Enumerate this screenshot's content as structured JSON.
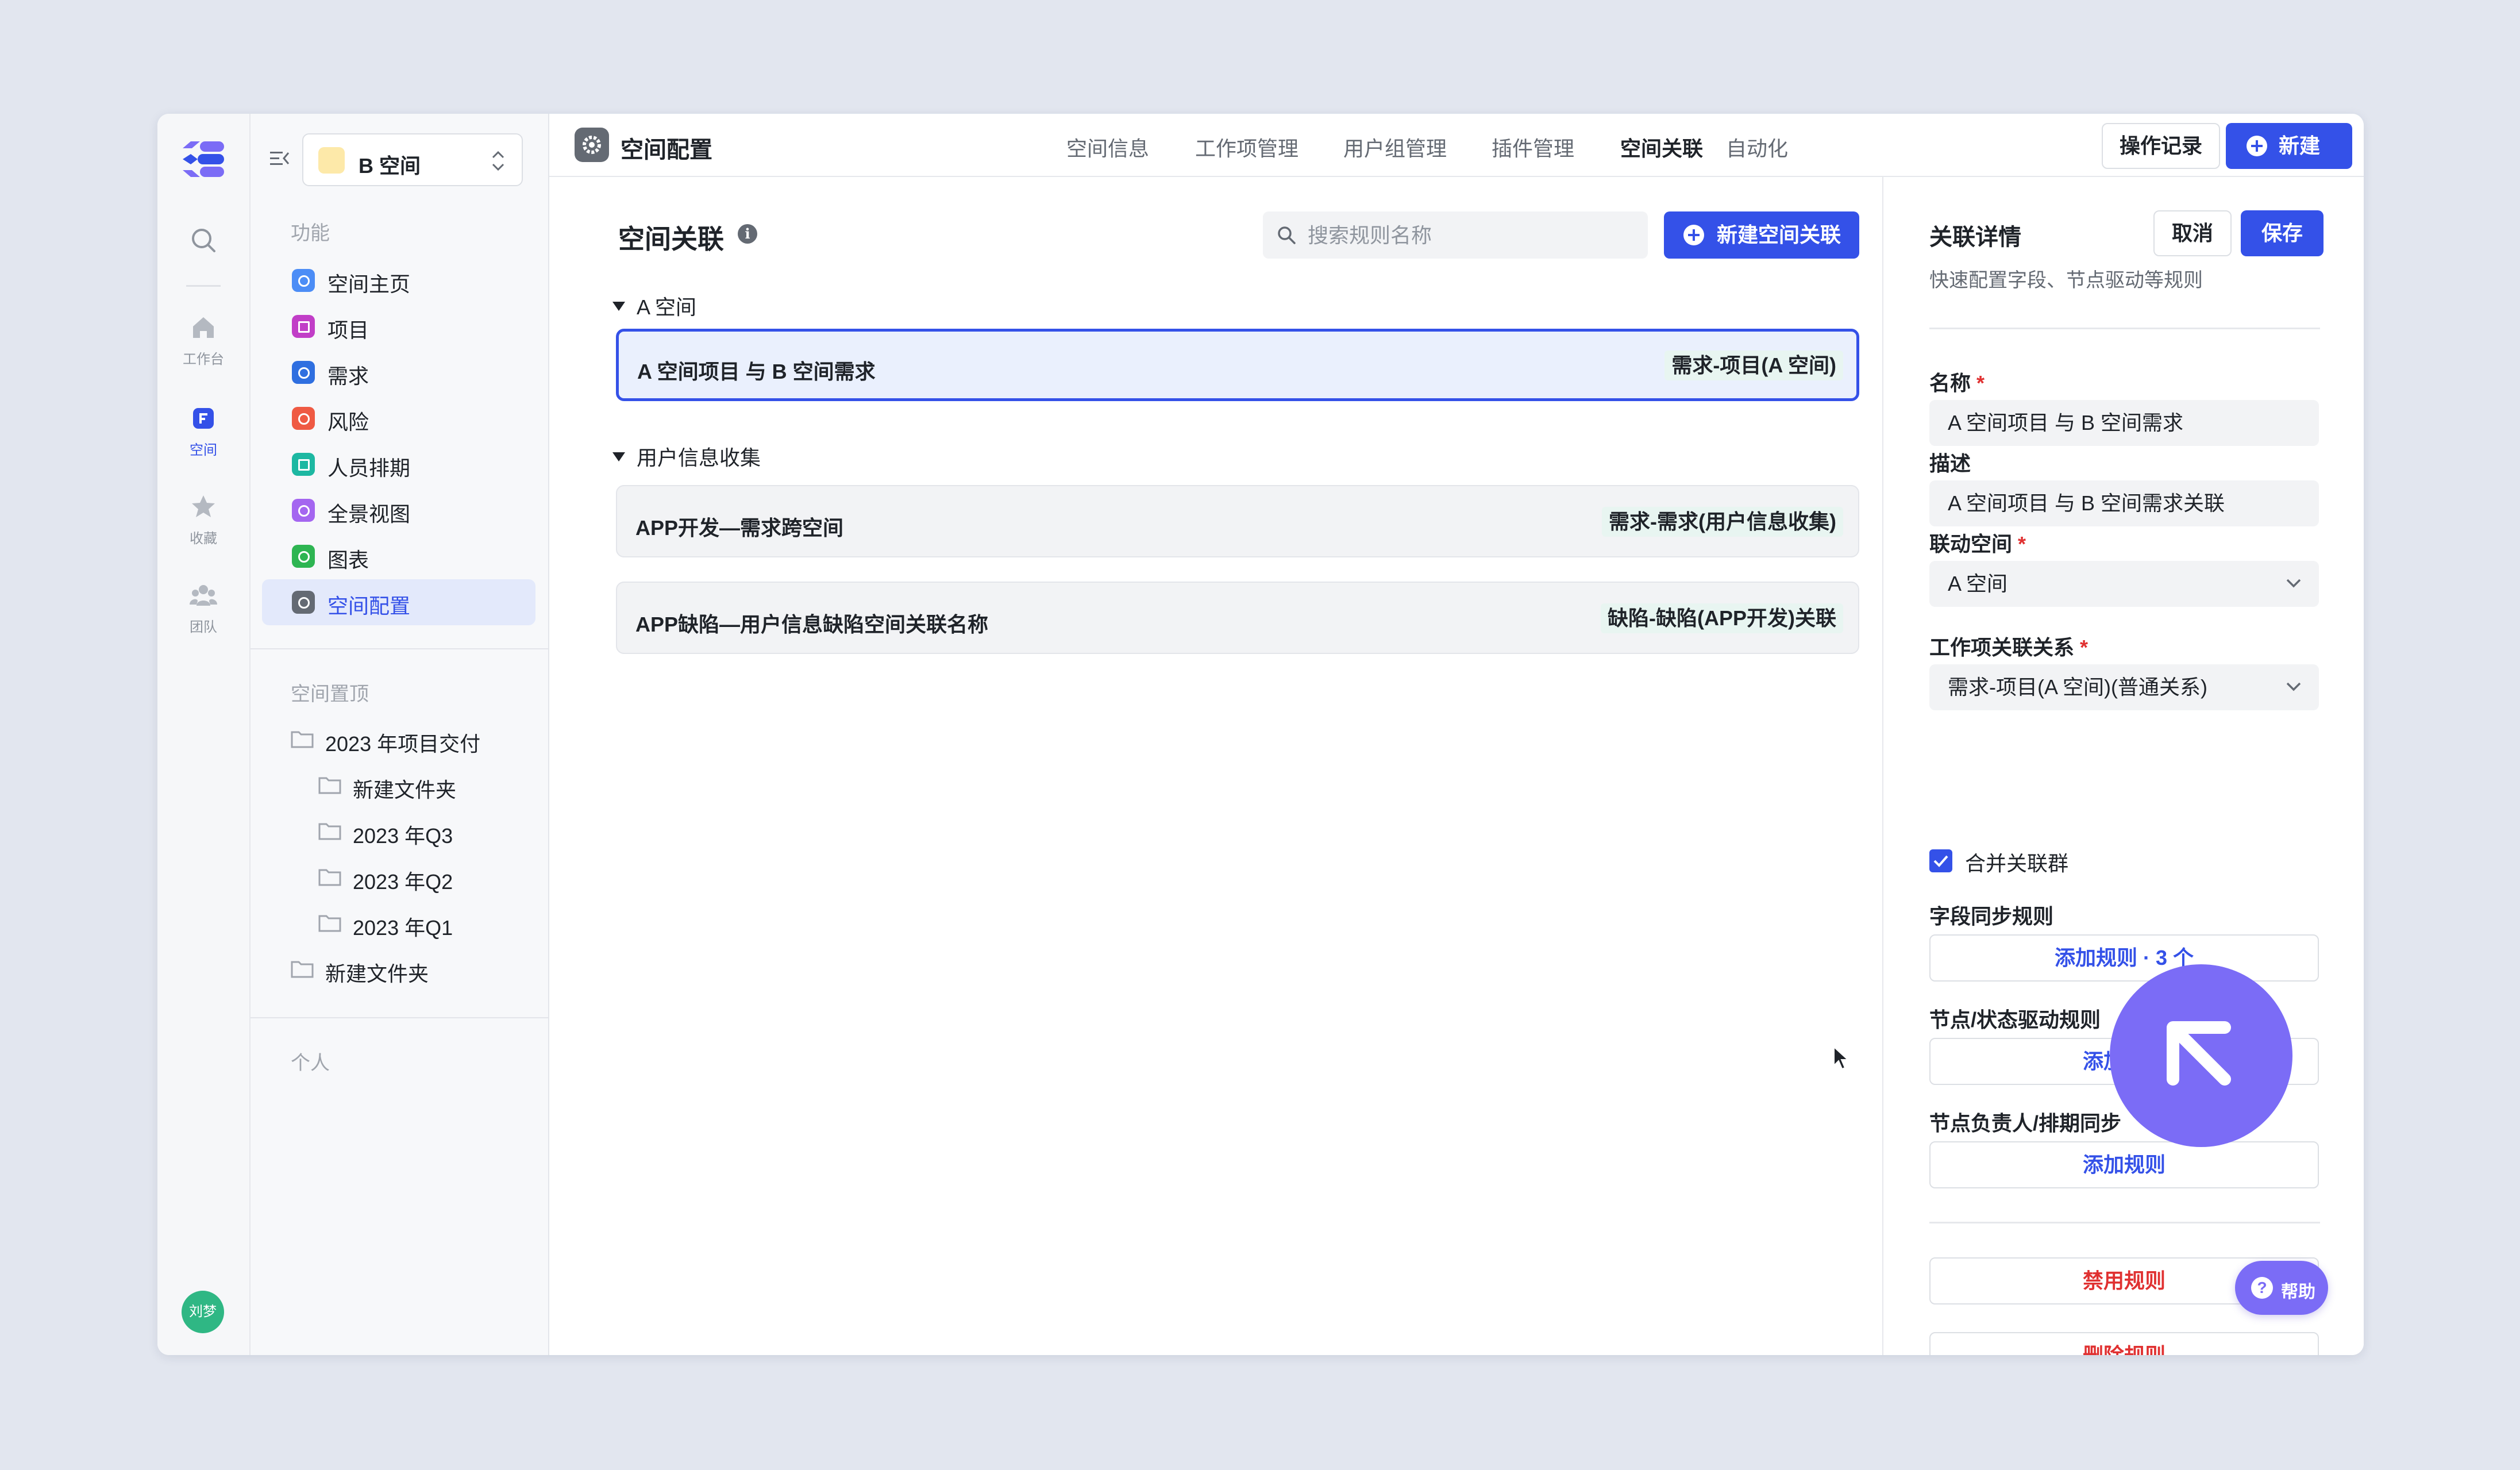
{
  "rail": {
    "items": [
      {
        "label": "工作台",
        "icon": "home-icon"
      },
      {
        "label": "空间",
        "icon": "space-icon"
      },
      {
        "label": "收藏",
        "icon": "star-icon"
      },
      {
        "label": "团队",
        "icon": "team-icon"
      }
    ],
    "avatar_text": "刘梦"
  },
  "sidebar": {
    "space_name": "B 空间",
    "section_function": "功能",
    "items": [
      {
        "label": "空间主页",
        "color": "#4c8df6"
      },
      {
        "label": "项目",
        "color": "#c13ec7"
      },
      {
        "label": "需求",
        "color": "#2f6fe0"
      },
      {
        "label": "风险",
        "color": "#ef5a43"
      },
      {
        "label": "人员排期",
        "color": "#1db8a2"
      },
      {
        "label": "全景视图",
        "color": "#a466f0"
      },
      {
        "label": "图表",
        "color": "#2eb552"
      },
      {
        "label": "空间配置",
        "color": "#646a73"
      }
    ],
    "section_pinned": "空间置顶",
    "folders": [
      {
        "label": "2023 年项目交付"
      },
      {
        "label": "新建文件夹"
      },
      {
        "label": "2023 年Q3"
      },
      {
        "label": "2023 年Q2"
      },
      {
        "label": "2023 年Q1"
      },
      {
        "label": "新建文件夹"
      }
    ],
    "section_personal": "个人"
  },
  "topbar": {
    "title": "空间配置",
    "tabs": [
      "空间信息",
      "工作项管理",
      "用户组管理",
      "插件管理",
      "空间关联",
      "自动化"
    ],
    "active_tab": "空间关联",
    "log_label": "操作记录",
    "new_label": "新建"
  },
  "main": {
    "heading": "空间关联",
    "info_glyph": "i",
    "search_placeholder": "搜索规则名称",
    "add_label": "新建空间关联",
    "groups": [
      {
        "name": "A 空间",
        "rules": [
          {
            "name": "A 空间项目 与 B 空间需求",
            "tag": "需求-项目(A 空间)"
          }
        ]
      },
      {
        "name": "用户信息收集",
        "rules": [
          {
            "name": "APP开发—需求跨空间",
            "tag": "需求-需求(用户信息收集)"
          },
          {
            "name": "APP缺陷—用户信息缺陷空间关联名称",
            "tag": "缺陷-缺陷(APP开发)关联"
          }
        ]
      }
    ]
  },
  "panel": {
    "title": "关联详情",
    "subtitle": "快速配置字段、节点驱动等规则",
    "cancel_label": "取消",
    "save_label": "保存",
    "name_label": "名称",
    "name_value": "A 空间项目 与 B 空间需求",
    "desc_label": "描述",
    "desc_value": "A 空间项目 与 B 空间需求关联",
    "linked_label": "联动空间",
    "linked_value": "A 空间",
    "relation_label": "工作项关联关系",
    "relation_value": "需求-项目(A 空间)(普通关系)",
    "merge_label": "合并关联群",
    "merge_checked": true,
    "field_sync_label": "字段同步规则",
    "field_sync_btn": "添加规则 · 3 个",
    "node_label": "节点/状态驱动规则",
    "node_btn": "添加规则",
    "owner_label": "节点负责人/排期同步",
    "owner_btn": "添加规则",
    "disable_btn": "禁用规则",
    "delete_btn": "删除规则",
    "required_mark": "*"
  },
  "help_label": "帮助",
  "colors": {
    "accent": "#3451e8",
    "danger": "#e03131",
    "fab": "#7b6cf6"
  }
}
